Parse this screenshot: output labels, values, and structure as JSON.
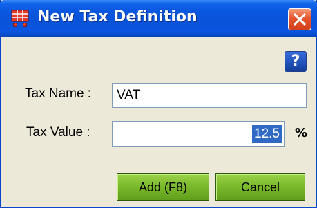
{
  "window": {
    "title": "New Tax Definition",
    "title_icon": "shopping-cart-icon",
    "close_icon": "close-icon",
    "help_label": "?"
  },
  "form": {
    "tax_name_label": "Tax Name :",
    "tax_name_value": "VAT",
    "tax_value_label": "Tax Value :",
    "tax_value_value": "12.5",
    "percent_symbol": "%"
  },
  "buttons": {
    "add_label": "Add (F8)",
    "cancel_label": "Cancel"
  },
  "colors": {
    "titlebar": "#0a57df",
    "close_button": "#e5542e",
    "action_button": "#7ebc2f",
    "selection": "#316ac5"
  }
}
